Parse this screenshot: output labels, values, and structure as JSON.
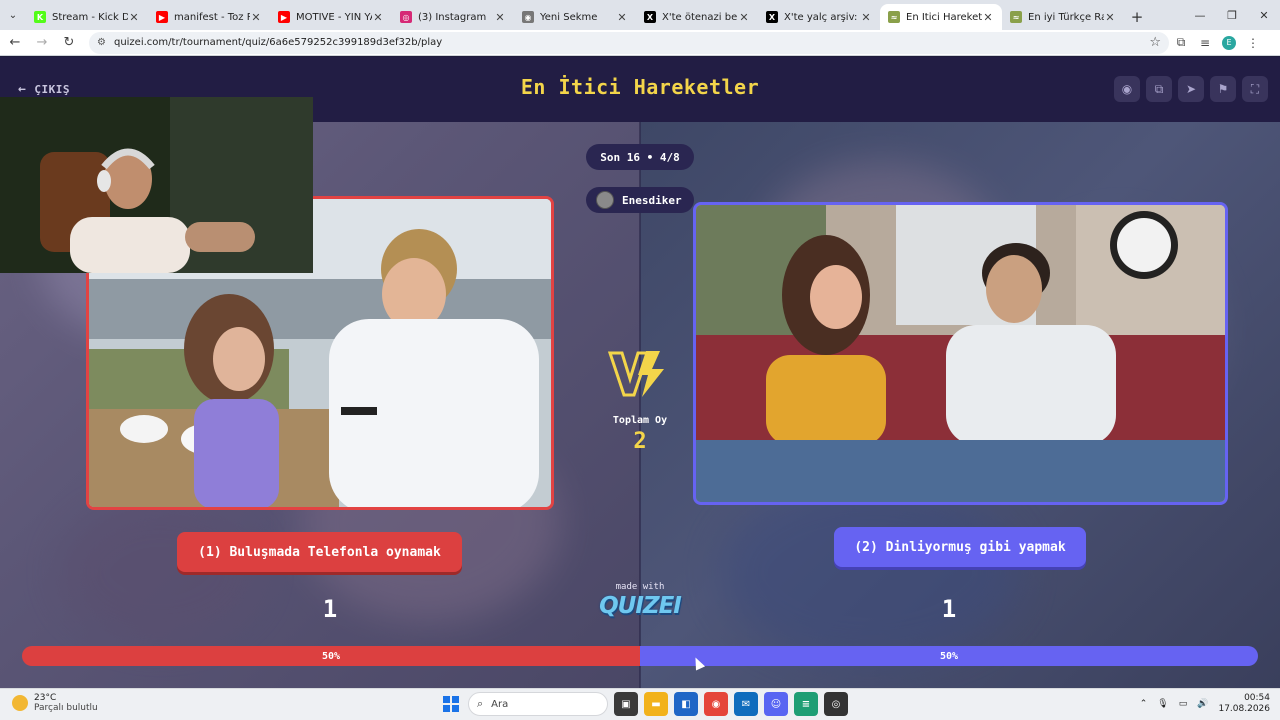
{
  "browser": {
    "tabs": [
      {
        "title": "Stream - Kick Dashbo",
        "favicon_color": "#53fc18",
        "favicon_glyph": "K",
        "active": false
      },
      {
        "title": "manifest - Toz Pembe",
        "favicon_color": "#ff0000",
        "favicon_glyph": "▶",
        "active": false
      },
      {
        "title": "MOTIVE - YIN YA",
        "favicon_color": "#ff0000",
        "favicon_glyph": "▶",
        "active": false
      },
      {
        "title": "(3) Instagram",
        "favicon_color": "#d62976",
        "favicon_glyph": "◎",
        "active": false
      },
      {
        "title": "Yeni Sekme",
        "favicon_color": "#777777",
        "favicon_glyph": "◉",
        "active": false
      },
      {
        "title": "X'te ötenazi bekliyor",
        "favicon_color": "#000000",
        "favicon_glyph": "X",
        "active": false
      },
      {
        "title": "X'te yalç arşiv: \"kurtla",
        "favicon_color": "#000000",
        "favicon_glyph": "X",
        "active": false
      },
      {
        "title": "En İtici Hareketler - T",
        "favicon_color": "#8aa04a",
        "favicon_glyph": "≈",
        "active": true
      },
      {
        "title": "En iyi Türkçe Rap Şar",
        "favicon_color": "#8aa04a",
        "favicon_glyph": "≈",
        "active": false
      }
    ],
    "url": "quizei.com/tr/tournament/quiz/6a6e579252c399189d3ef32b/play",
    "profile_initial": "E"
  },
  "header": {
    "exit_label": "ÇIKIŞ",
    "title": "En İtici Hareketler",
    "buttons": [
      {
        "icon": "eye-icon",
        "glyph": "◉"
      },
      {
        "icon": "copy-icon",
        "glyph": "⧉"
      },
      {
        "icon": "send-icon",
        "glyph": "➤"
      },
      {
        "icon": "flag-icon",
        "glyph": "⚑"
      },
      {
        "icon": "fullscreen-icon",
        "glyph": "⛶"
      }
    ]
  },
  "round": "Son 16 • 4/8",
  "user": "Enesdiker",
  "vs_label": "VS",
  "total_votes_label": "Toplam Oy",
  "total_votes": "2",
  "options": {
    "left": {
      "label": "(1) Buluşmada Telefonla oynamak",
      "votes": "1",
      "percent_label": "50%",
      "percent": 50,
      "color": "#dc4040"
    },
    "right": {
      "label": "(2) Dinliyormuş gibi yapmak",
      "votes": "1",
      "percent_label": "50%",
      "percent": 50,
      "color": "#6663f2"
    }
  },
  "made_with": "made with",
  "brand": "QUIZEI",
  "taskbar": {
    "temperature": "23°C",
    "weather": "Parçalı bulutlu",
    "search_placeholder": "Ara",
    "time": "00:54",
    "date": "17.08.2026"
  }
}
